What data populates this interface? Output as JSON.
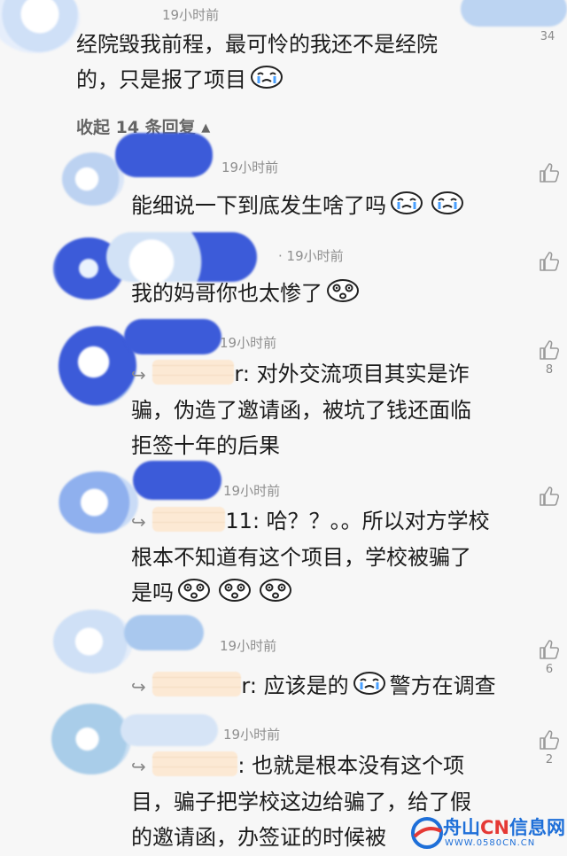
{
  "top_comment": {
    "time": "19小时前",
    "text_line1": "经院毁我前程，最可怜的我还不是经院",
    "text_line2": "的，只是报了项目",
    "like_count": "34"
  },
  "collapse": {
    "label": "收起 14 条回复"
  },
  "replies": [
    {
      "time": "19小时前",
      "lines": [
        "能细说一下到底发生啥了吗"
      ],
      "like_count": ""
    },
    {
      "time": "· 19小时前",
      "lines": [
        "我的妈哥你也太惨了"
      ],
      "like_count": ""
    },
    {
      "time": "19小时前",
      "quote_suffix": "r:",
      "lines": [
        "对外交流项目其实是诈",
        "骗，伪造了邀请函，被坑了钱还面临",
        "拒签十年的后果"
      ],
      "like_count": "8"
    },
    {
      "time": "19小时前",
      "quote_suffix": "11:",
      "lines": [
        "哈？？。。所以对方学校",
        "根本不知道有这个项目，学校被骗了",
        "是吗"
      ],
      "like_count": ""
    },
    {
      "time": "19小时前",
      "quote_suffix": "r:",
      "lines": [
        "应该是的",
        "警方在调查"
      ],
      "like_count": "6"
    },
    {
      "time": "19小时前",
      "quote_suffix": ":",
      "lines": [
        "也就是根本没有这个项",
        "目，骗子把学校这边给骗了，给了假",
        "的邀请函，办签证的时候被"
      ],
      "like_count": "2"
    }
  ],
  "watermark": {
    "name_a": "舟山",
    "name_b": "CN",
    "name_c": "信息网",
    "url": "WWW.0580CN.CN"
  },
  "colors": {
    "blue": "#3c5bd9",
    "light_blue": "#a9c8ee",
    "peach": "#fde5cc",
    "text": "#1b1b1b",
    "muted": "#8f8f8f"
  }
}
